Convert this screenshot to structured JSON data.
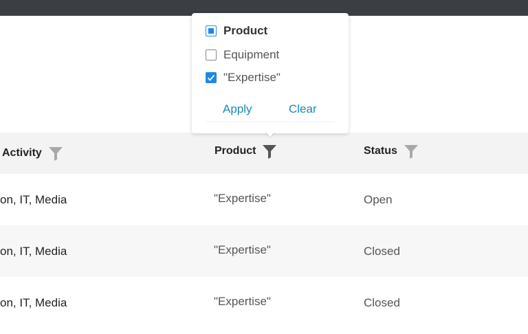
{
  "table": {
    "headers": {
      "activity": "Activity",
      "product": "Product",
      "status": "Status"
    },
    "rows": [
      {
        "activity": "on, IT, Media",
        "product": "\"Expertise\"",
        "status": "Open"
      },
      {
        "activity": "on, IT, Media",
        "product": "\"Expertise\"",
        "status": "Closed"
      },
      {
        "activity": "on, IT, Media",
        "product": "\"Expertise\"",
        "status": "Closed"
      }
    ]
  },
  "filter_popup": {
    "options": [
      {
        "label": "Product",
        "state": "indeterminate"
      },
      {
        "label": "Equipment",
        "state": "unchecked"
      },
      {
        "label": "\"Expertise\"",
        "state": "checked"
      }
    ],
    "apply_label": "Apply",
    "clear_label": "Clear"
  },
  "colors": {
    "accent": "#1e88e5",
    "link": "#1a8ab5",
    "topbar": "#3b3e42",
    "header_bg": "#f3f3f3",
    "filter_active": "#555555",
    "filter_inactive": "#a8a8a8"
  }
}
